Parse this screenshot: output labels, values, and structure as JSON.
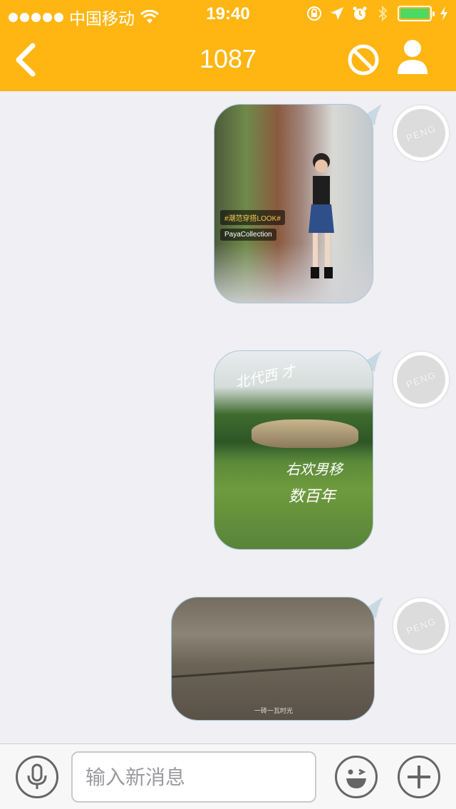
{
  "status_bar": {
    "carrier": "中国移动",
    "time": "19:40",
    "battery_level": 1.0,
    "icons": [
      "signal-dots-icon",
      "wifi-icon",
      "rotation-lock-icon",
      "location-arrow-icon",
      "alarm-icon",
      "bluetooth-icon",
      "battery-icon",
      "charging-icon"
    ]
  },
  "nav": {
    "title": "1087",
    "back_icon": "chevron-left-icon",
    "block_icon": "block-icon",
    "profile_icon": "person-icon"
  },
  "messages": [
    {
      "avatar_text": "PENG",
      "image": {
        "tag_text": "#潮范穿搭LOOK#",
        "tag2_text": "PayaCollection"
      }
    },
    {
      "avatar_text": "PENG",
      "image": {
        "text1": "北代西 才",
        "text2": "右欢男移",
        "text3": "数百年"
      }
    },
    {
      "avatar_text": "PENG",
      "image": {
        "caption": "一砖一瓦时光"
      }
    }
  ],
  "input_bar": {
    "placeholder": "输入新消息",
    "value": "",
    "mic_icon": "microphone-icon",
    "emoji_icon": "wink-face-icon",
    "plus_icon": "plus-icon"
  },
  "colors": {
    "accent": "#ffb612",
    "background": "#efeff4",
    "bubble_border": "#a9c7d6"
  }
}
